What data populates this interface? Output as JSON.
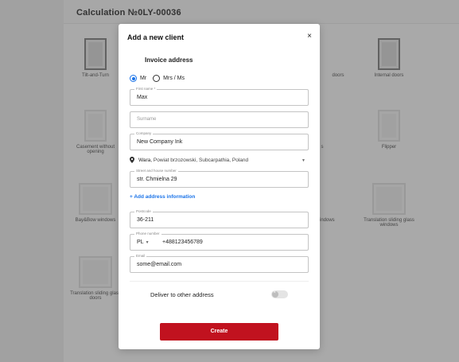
{
  "background": {
    "title": "Calculation №0LY-00036",
    "products": [
      {
        "label": "Tilt-and-Turn"
      },
      {
        "label": "doors"
      },
      {
        "label": "Internal doors"
      },
      {
        "label": "Casement without opening"
      },
      {
        "label": "s"
      },
      {
        "label": "Flipper"
      },
      {
        "label": "Bay&Bow windows"
      },
      {
        "label": "on windows"
      },
      {
        "label": "Translation sliding glass windows"
      },
      {
        "label": "Translation sliding glass doors"
      }
    ]
  },
  "modal": {
    "title": "Add a new client",
    "close_icon": "×",
    "section_title": "Invoice address",
    "salutation": {
      "options": [
        "Mr",
        "Mrs / Ms"
      ],
      "selected": "Mr"
    },
    "first_name": {
      "label": "First name *",
      "value": "Max"
    },
    "surname": {
      "placeholder": "Surname"
    },
    "company": {
      "label": "Company",
      "value": "New Company Ink"
    },
    "location": {
      "city": "Wara,",
      "region": " Powiat brzozowski, Subcarpathia, Poland"
    },
    "street": {
      "label": "Street and house number",
      "value": "str. Chmielna 29"
    },
    "add_address_link": "+ Add address information",
    "postcode": {
      "label": "Postcode",
      "value": "36-211"
    },
    "phone": {
      "label": "Phone number",
      "country": "PL",
      "value": "+488123456789"
    },
    "email": {
      "label": "Email",
      "value": "some@email.com"
    },
    "deliver_label": "Deliver to other address",
    "deliver_toggle_on": false,
    "create_button": "Create"
  },
  "colors": {
    "accent": "#1a73e8",
    "primary_button": "#c1121f"
  }
}
